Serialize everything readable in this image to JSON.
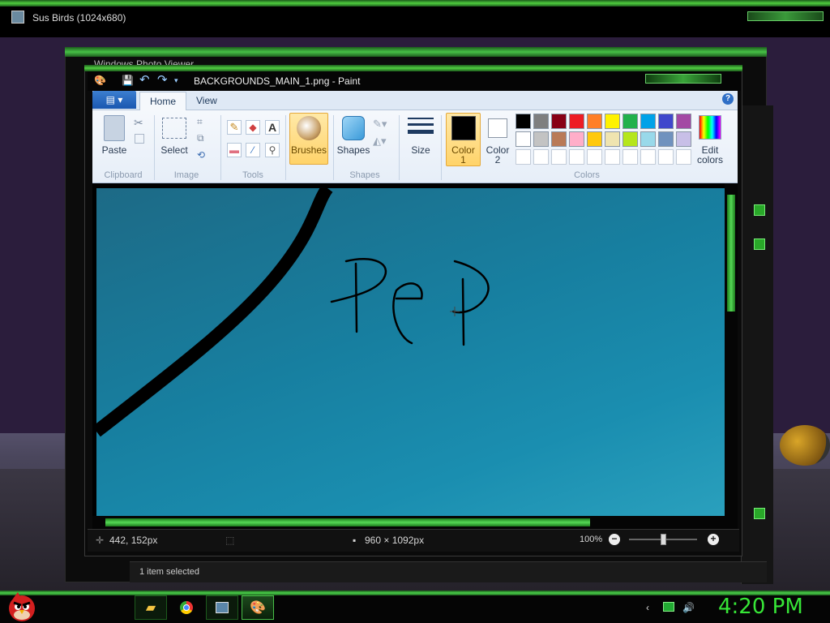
{
  "background_window": {
    "title": "Sus Birds (1024x680)"
  },
  "photo_viewer": {
    "title": "Windows Photo Viewer",
    "status": "1 item selected"
  },
  "paint": {
    "title": "BACKGROUNDS_MAIN_1.png - Paint",
    "tabs": [
      "Home",
      "View"
    ],
    "groups": {
      "clipboard": {
        "label": "Clipboard",
        "paste": "Paste"
      },
      "image": {
        "label": "Image",
        "select": "Select"
      },
      "tools": {
        "label": "Tools"
      },
      "brushes": {
        "label": "Brushes"
      },
      "shapes": {
        "label": "Shapes",
        "button": "Shapes"
      },
      "size": {
        "label": "Size"
      },
      "colors": {
        "label": "Colors",
        "color1_l1": "Color",
        "color1_l2": "1",
        "color2_l1": "Color",
        "color2_l2": "2",
        "edit_l1": "Edit",
        "edit_l2": "colors",
        "color1_value": "#000000",
        "color2_value": "#ffffff",
        "palette_row1": [
          "#000000",
          "#7f7f7f",
          "#880015",
          "#ed1c24",
          "#ff7f27",
          "#fff200",
          "#22b14c",
          "#00a2e8",
          "#3f48cc",
          "#a349a4"
        ],
        "palette_row2": [
          "#ffffff",
          "#c3c3c3",
          "#b97a57",
          "#ffaec9",
          "#ffc90e",
          "#efe4b0",
          "#b5e61d",
          "#99d9ea",
          "#7092be",
          "#c8bfe7"
        ]
      }
    },
    "canvas_text": "PeP",
    "status": {
      "cursor": "442, 152px",
      "dimensions": "960 × 1092px",
      "zoom": "100%"
    }
  },
  "taskbar": {
    "time": "4:20 PM",
    "apps": [
      "folder-icon",
      "chrome-icon",
      "photo-viewer-icon",
      "paint-icon"
    ]
  }
}
